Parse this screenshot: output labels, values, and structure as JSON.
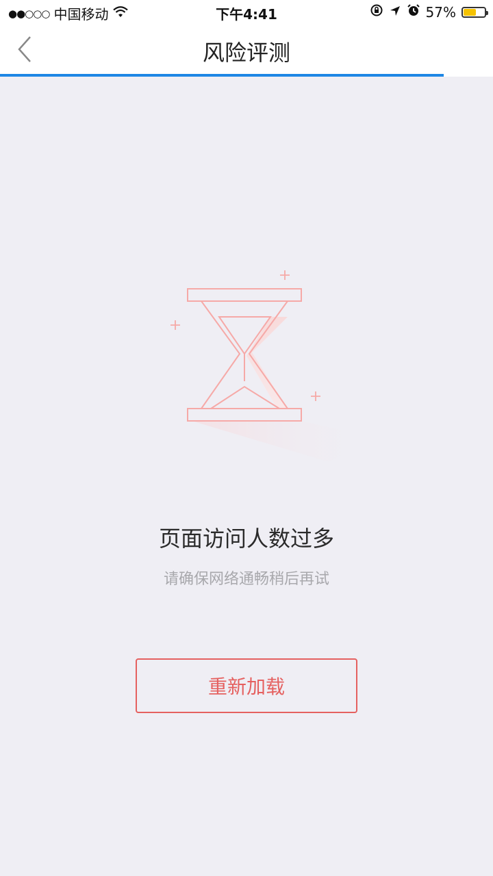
{
  "status_bar": {
    "carrier": "中国移动",
    "time": "下午4:41",
    "battery_percent": "57%",
    "battery_level": 0.57,
    "icons": [
      "signal-dots-icon",
      "wifi-icon",
      "rotation-lock-icon",
      "location-arrow-icon",
      "alarm-icon",
      "battery-icon"
    ]
  },
  "nav": {
    "title": "风险评测",
    "back_icon": "chevron-left-icon"
  },
  "page_load_progress": 0.9,
  "error": {
    "illustration_icon": "hourglass-icon",
    "title": "页面访问人数过多",
    "subtitle": "请确保网络通畅稍后再试"
  },
  "actions": {
    "reload_label": "重新加载"
  },
  "colors": {
    "accent_blue": "#1e87e5",
    "accent_red": "#e5605f",
    "background": "#efeef4"
  }
}
